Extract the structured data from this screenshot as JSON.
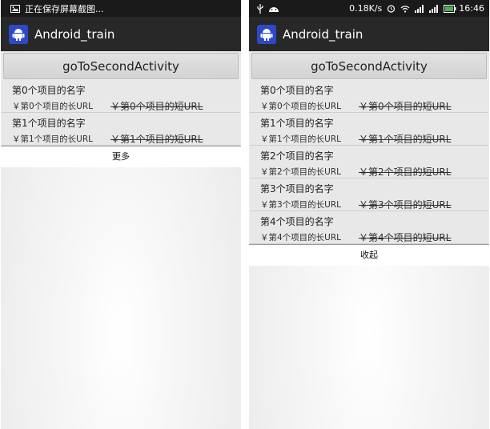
{
  "colors": {
    "status_bar": "#1a1a1a",
    "action_bar": "#282828",
    "app_icon": "#2e49c7",
    "battery": "#4caf50"
  },
  "left": {
    "status": {
      "text": "正在保存屏幕截图...",
      "icon": "screenshot-icon"
    },
    "app_title": "Android_train",
    "button_label": "goToSecondActivity",
    "items": [
      {
        "name": "第0个项目的名字",
        "long_url": "￥第0个项目的长URL",
        "short_url": "￥第0个项目的短URL"
      },
      {
        "name": "第1个项目的名字",
        "long_url": "￥第1个项目的长URL",
        "short_url": "￥第1个项目的短URL"
      }
    ],
    "footer_label": "更多"
  },
  "right": {
    "status": {
      "speed": "0.18K/s",
      "time": "16:46",
      "icons": [
        "usb-icon",
        "android-icon",
        "alarm-icon",
        "wifi-icon",
        "signal-icon",
        "signal-icon",
        "battery-icon"
      ]
    },
    "app_title": "Android_train",
    "button_label": "goToSecondActivity",
    "items": [
      {
        "name": "第0个项目的名字",
        "long_url": "￥第0个项目的长URL",
        "short_url": "￥第0个项目的短URL"
      },
      {
        "name": "第1个项目的名字",
        "long_url": "￥第1个项目的长URL",
        "short_url": "￥第1个项目的短URL"
      },
      {
        "name": "第2个项目的名字",
        "long_url": "￥第2个项目的长URL",
        "short_url": "￥第2个项目的短URL"
      },
      {
        "name": "第3个项目的名字",
        "long_url": "￥第3个项目的长URL",
        "short_url": "￥第3个项目的短URL"
      },
      {
        "name": "第4个项目的名字",
        "long_url": "￥第4个项目的长URL",
        "short_url": "￥第4个项目的短URL"
      }
    ],
    "footer_label": "收起"
  }
}
